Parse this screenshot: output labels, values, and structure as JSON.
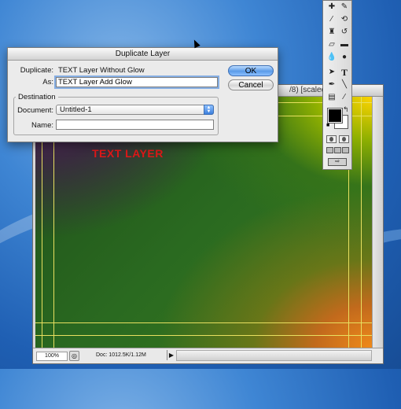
{
  "dialog": {
    "title": "Duplicate Layer",
    "duplicate_label": "Duplicate:",
    "duplicate_value": "TEXT Layer Without Glow",
    "as_label": "As:",
    "as_value": "TEXT Layer Add Glow",
    "ok_label": "OK",
    "cancel_label": "Cancel",
    "destination_legend": "Destination",
    "document_label": "Document:",
    "document_value": "Untitled-1",
    "name_label": "Name:",
    "name_value": ""
  },
  "document_window": {
    "title_fragment": "/8) [scaled]",
    "canvas_text": "TEXT LAYER",
    "zoom": "100%",
    "doc_size": "Doc: 1012.5K/1.12M"
  },
  "tools": {
    "text_tool_glyph": "T"
  },
  "colors": {
    "canvas_text": "#e01818",
    "guide": "#e8e060",
    "ok_button": "#5b9be8",
    "foreground": "#000000",
    "background": "#ffffff"
  }
}
